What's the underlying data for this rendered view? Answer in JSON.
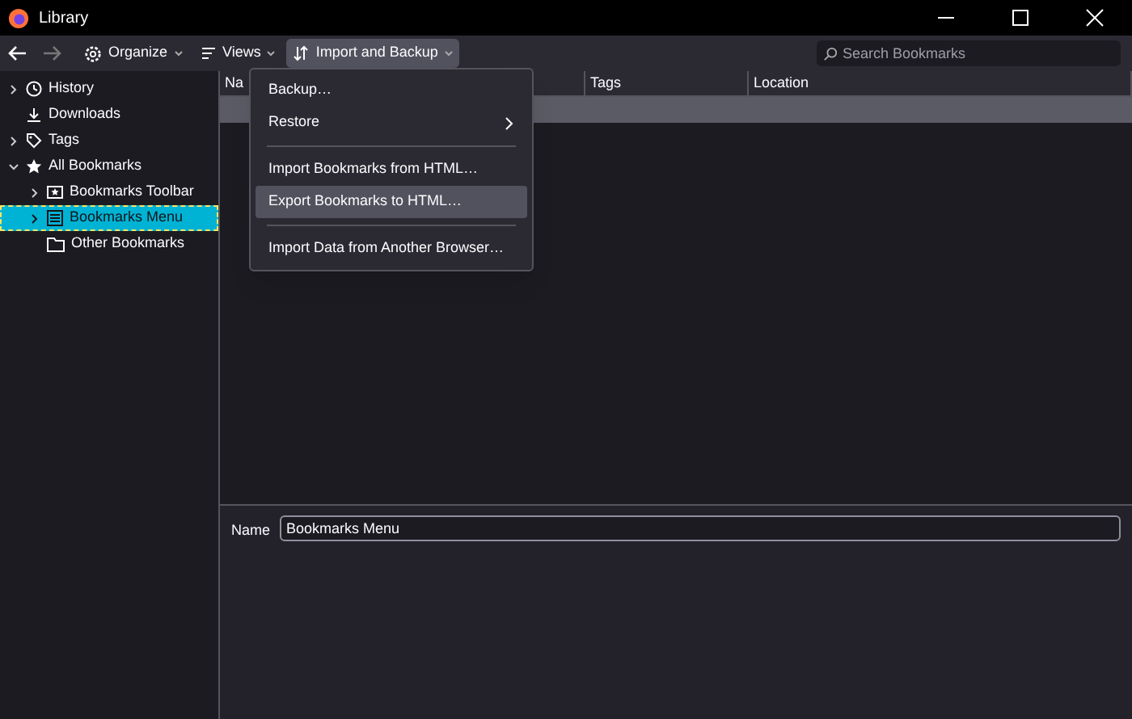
{
  "window": {
    "title": "Library"
  },
  "toolbar": {
    "buttons": [
      {
        "label": "Organize",
        "selected": false
      },
      {
        "label": "Views",
        "selected": false
      },
      {
        "label": "Import and Backup",
        "selected": true
      }
    ],
    "search": {
      "placeholder": "Search Bookmarks"
    }
  },
  "sidebar": {
    "items": [
      {
        "label": "History",
        "kind": "folder",
        "expanded": false,
        "selected": false
      },
      {
        "label": "Downloads",
        "kind": "leaf",
        "selected": false
      },
      {
        "label": "Tags",
        "kind": "folder",
        "expanded": false,
        "selected": false
      },
      {
        "label": "All Bookmarks",
        "kind": "folder",
        "expanded": true,
        "selected": false,
        "children": [
          {
            "label": "Bookmarks Toolbar",
            "kind": "folder",
            "expanded": false,
            "selected": false
          },
          {
            "label": "Bookmarks Menu",
            "kind": "folder",
            "expanded": false,
            "selected": true
          },
          {
            "label": "Other Bookmarks",
            "kind": "leaf",
            "selected": false
          }
        ]
      }
    ]
  },
  "table": {
    "columns": [
      "Na",
      "Tags",
      "Location"
    ]
  },
  "menu": {
    "items": [
      {
        "kind": "item",
        "label": "Backup…",
        "submenu": false,
        "selected": false
      },
      {
        "kind": "item",
        "label": "Restore",
        "submenu": true,
        "selected": false
      },
      {
        "kind": "separator"
      },
      {
        "kind": "item",
        "label": "Import Bookmarks from HTML…",
        "submenu": false,
        "selected": false
      },
      {
        "kind": "item",
        "label": "Export Bookmarks to HTML…",
        "submenu": false,
        "selected": true
      },
      {
        "kind": "separator"
      },
      {
        "kind": "item",
        "label": "Import Data from Another Browser…",
        "submenu": false,
        "selected": false
      }
    ]
  },
  "details": {
    "name_label": "Name",
    "name_value": "Bookmarks Menu"
  }
}
